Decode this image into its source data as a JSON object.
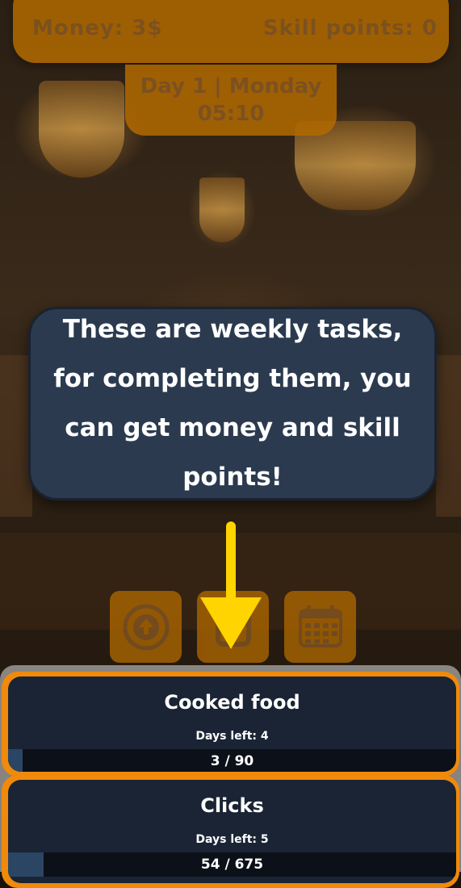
{
  "header": {
    "money": "Money: 3$",
    "skill_points": "Skill points: 0"
  },
  "clock": {
    "day": "Day 1 | Monday",
    "time": "05:10"
  },
  "tutorial": {
    "message": "These are weekly tasks, for completing them, you can get money and skill points!"
  },
  "toolbar": {
    "buttons": [
      {
        "icon": "upgrade-arrow-icon"
      },
      {
        "icon": "tasks-box-icon"
      },
      {
        "icon": "calendar-icon"
      }
    ]
  },
  "tasks": [
    {
      "title": "Cooked food",
      "days_left": "Days left: 4",
      "progress_label": "3 / 90",
      "progress": 0.033
    },
    {
      "title": "Clicks",
      "days_left": "Days left: 5",
      "progress_label": "54 / 675",
      "progress": 0.08
    }
  ],
  "colors": {
    "accent_orange": "#f08a0c",
    "panel_dark": "#1b2434",
    "bubble": "#2b3a4f",
    "arrow": "#ffd400"
  }
}
